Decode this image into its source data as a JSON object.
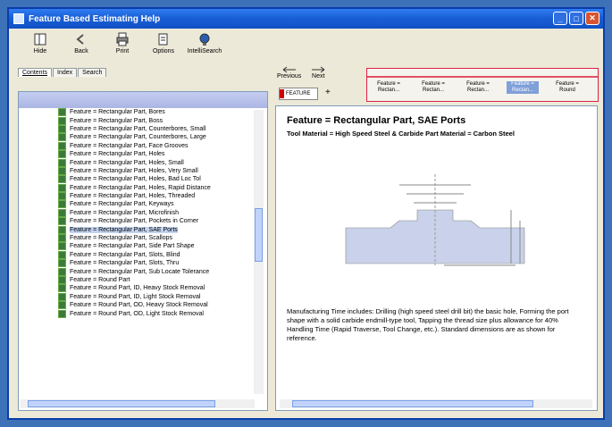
{
  "window": {
    "title": "Feature Based Estimating Help"
  },
  "toolbar": {
    "buttons": [
      {
        "label": "Hide",
        "icon": "hide-icon"
      },
      {
        "label": "Back",
        "icon": "back-arrow-icon"
      },
      {
        "label": "Print",
        "icon": "print-icon"
      },
      {
        "label": "Options",
        "icon": "options-icon"
      },
      {
        "label": "IntelliSearch",
        "icon": "globe-icon"
      }
    ]
  },
  "tabs": {
    "contents": "Contents",
    "index": "Index",
    "search": "Search"
  },
  "tree": {
    "items": [
      "Feature = Rectangular Part, Bores",
      "Feature = Rectangular Part, Boss",
      "Feature = Rectangular Part, Counterbores, Small",
      "Feature = Rectangular Part, Counterbores, Large",
      "Feature = Rectangular Part, Face Grooves",
      "Feature = Rectangular Part, Holes",
      "Feature = Rectangular Part, Holes, Small",
      "Feature = Rectangular Part, Holes, Very Small",
      "Feature = Rectangular Part, Holes, Bad Loc Tol",
      "Feature = Rectangular Part, Holes, Rapid Distance",
      "Feature = Rectangular Part, Holes, Threaded",
      "Feature = Rectangular Part, Keyways",
      "Feature = Rectangular Part, Microfinish",
      "Feature = Rectangular Part, Pockets in Corner",
      "Feature = Rectangular Part, SAE Ports",
      "Feature = Rectangular Part, Scallops",
      "Feature = Rectangular Part, Side Part Shape",
      "Feature = Rectangular Part, Slots, Blind",
      "Feature = Rectangular Part, Slots, Thru",
      "Feature = Rectangular Part, Sub Locate Tolerance",
      "Feature = Round Part",
      "Feature = Round Part, ID, Heavy Stock Removal",
      "Feature = Round Part, ID, Light Stock Removal",
      "Feature = Round Part, OD, Heavy Stock Removal",
      "Feature = Round Part, OD, Light Stock Removal"
    ],
    "selected_index": 14
  },
  "nav": {
    "previous": "Previous",
    "next": "Next"
  },
  "feature_box": {
    "label": "FEATURE"
  },
  "strip": {
    "items": [
      "Feature = Rectan...",
      "Feature = Rectan...",
      "Feature = Rectan...",
      "Feature = Rectan...",
      "Feature = Round"
    ],
    "highlighted_index": 3
  },
  "content": {
    "title": "Feature = Rectangular Part, SAE Ports",
    "subtitle": "Tool Material = High Speed Steel & Carbide Part Material = Carbon Steel",
    "body": "Manufacturing Time includes: Drilling (high speed steel drill bit) the basic hole, Forming the port shape with a solid carbide endmill-type tool, Tapping the thread size plus allowance for 40% Handling Time (Rapid Traverse, Tool Change, etc.). Standard dimensions are as shown for reference."
  },
  "colors": {
    "titlebar": "#1a5fd6",
    "desktop": "#3d72b9",
    "strip_accent": "#e05060",
    "highlight": "#7fa0d8"
  }
}
